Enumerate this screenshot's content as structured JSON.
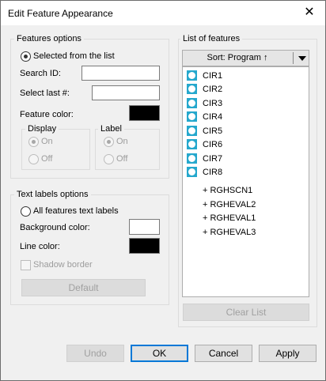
{
  "window": {
    "title": "Edit Feature Appearance",
    "close_glyph": "✕"
  },
  "features_options": {
    "group_label": "Features options",
    "selected_radio_label": "Selected from the list",
    "search_id_label": "Search ID:",
    "search_id_value": "",
    "select_last_label": "Select last #:",
    "select_last_value": "",
    "feature_color_label": "Feature color:",
    "feature_color": "#000000",
    "display": {
      "label": "Display",
      "on": "On",
      "off": "Off"
    },
    "label": {
      "label": "Label",
      "on": "On",
      "off": "Off"
    }
  },
  "text_labels": {
    "group_label": "Text labels options",
    "all_features_label": "All features text labels",
    "background_color_label": "Background color:",
    "background_color": "#ffffff",
    "line_color_label": "Line color:",
    "line_color": "#000000",
    "shadow_border_label": "Shadow border",
    "default_button": "Default"
  },
  "list_of_features": {
    "group_label": "List of features",
    "sort_label": "Sort: Program ↑",
    "items": [
      {
        "label": "CIR1",
        "icon": "circle-feature-icon"
      },
      {
        "label": "CIR2",
        "icon": "circle-feature-icon"
      },
      {
        "label": "CIR3",
        "icon": "circle-feature-icon"
      },
      {
        "label": "CIR4",
        "icon": "circle-feature-icon"
      },
      {
        "label": "CIR5",
        "icon": "circle-feature-icon"
      },
      {
        "label": "CIR6",
        "icon": "circle-feature-icon"
      },
      {
        "label": "CIR7",
        "icon": "circle-feature-icon"
      },
      {
        "label": "CIR8",
        "icon": "circle-feature-icon"
      },
      {
        "label": "+ RGHSCN1"
      },
      {
        "label": "+ RGHEVAL2"
      },
      {
        "label": "+ RGHEVAL1"
      },
      {
        "label": "+ RGHEVAL3"
      }
    ],
    "clear_button": "Clear List"
  },
  "footer": {
    "undo": "Undo",
    "ok": "OK",
    "cancel": "Cancel",
    "apply": "Apply"
  },
  "colors": {
    "feature_icon": "#25a8cd",
    "accent": "#0078d7"
  }
}
